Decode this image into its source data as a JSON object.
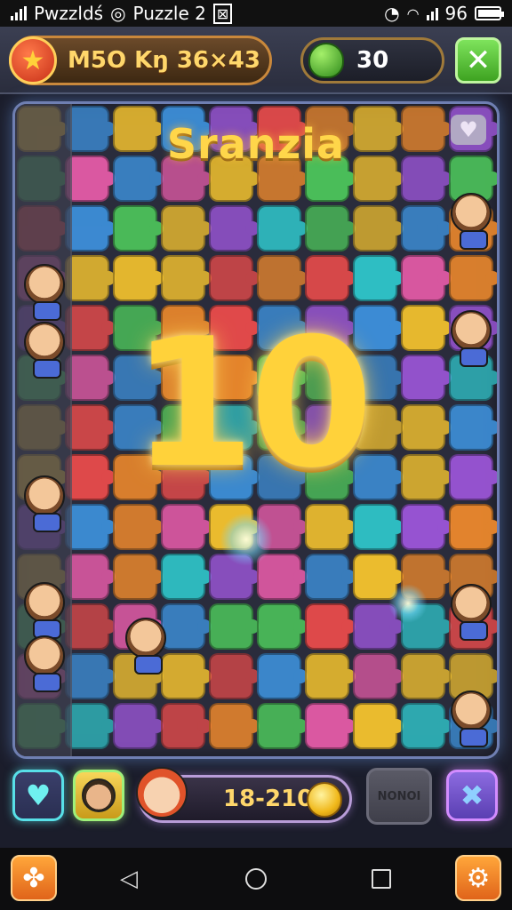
{
  "status_bar": {
    "left_text": "Pwzzldś",
    "app_name": "Puzzle 2",
    "battery": "96"
  },
  "hud": {
    "level_label": "M5O Kŋ 36×43",
    "gems": "30"
  },
  "board": {
    "title": "Sranzia",
    "big_number": "10",
    "colors": [
      "#3d8fd9",
      "#4cc25a",
      "#e84b4b",
      "#f2c12e",
      "#9a55d6",
      "#f08a2c",
      "#2fc4c9",
      "#e25aa6"
    ]
  },
  "tray": {
    "score": "18-210",
    "locked_label": "NONOI"
  }
}
